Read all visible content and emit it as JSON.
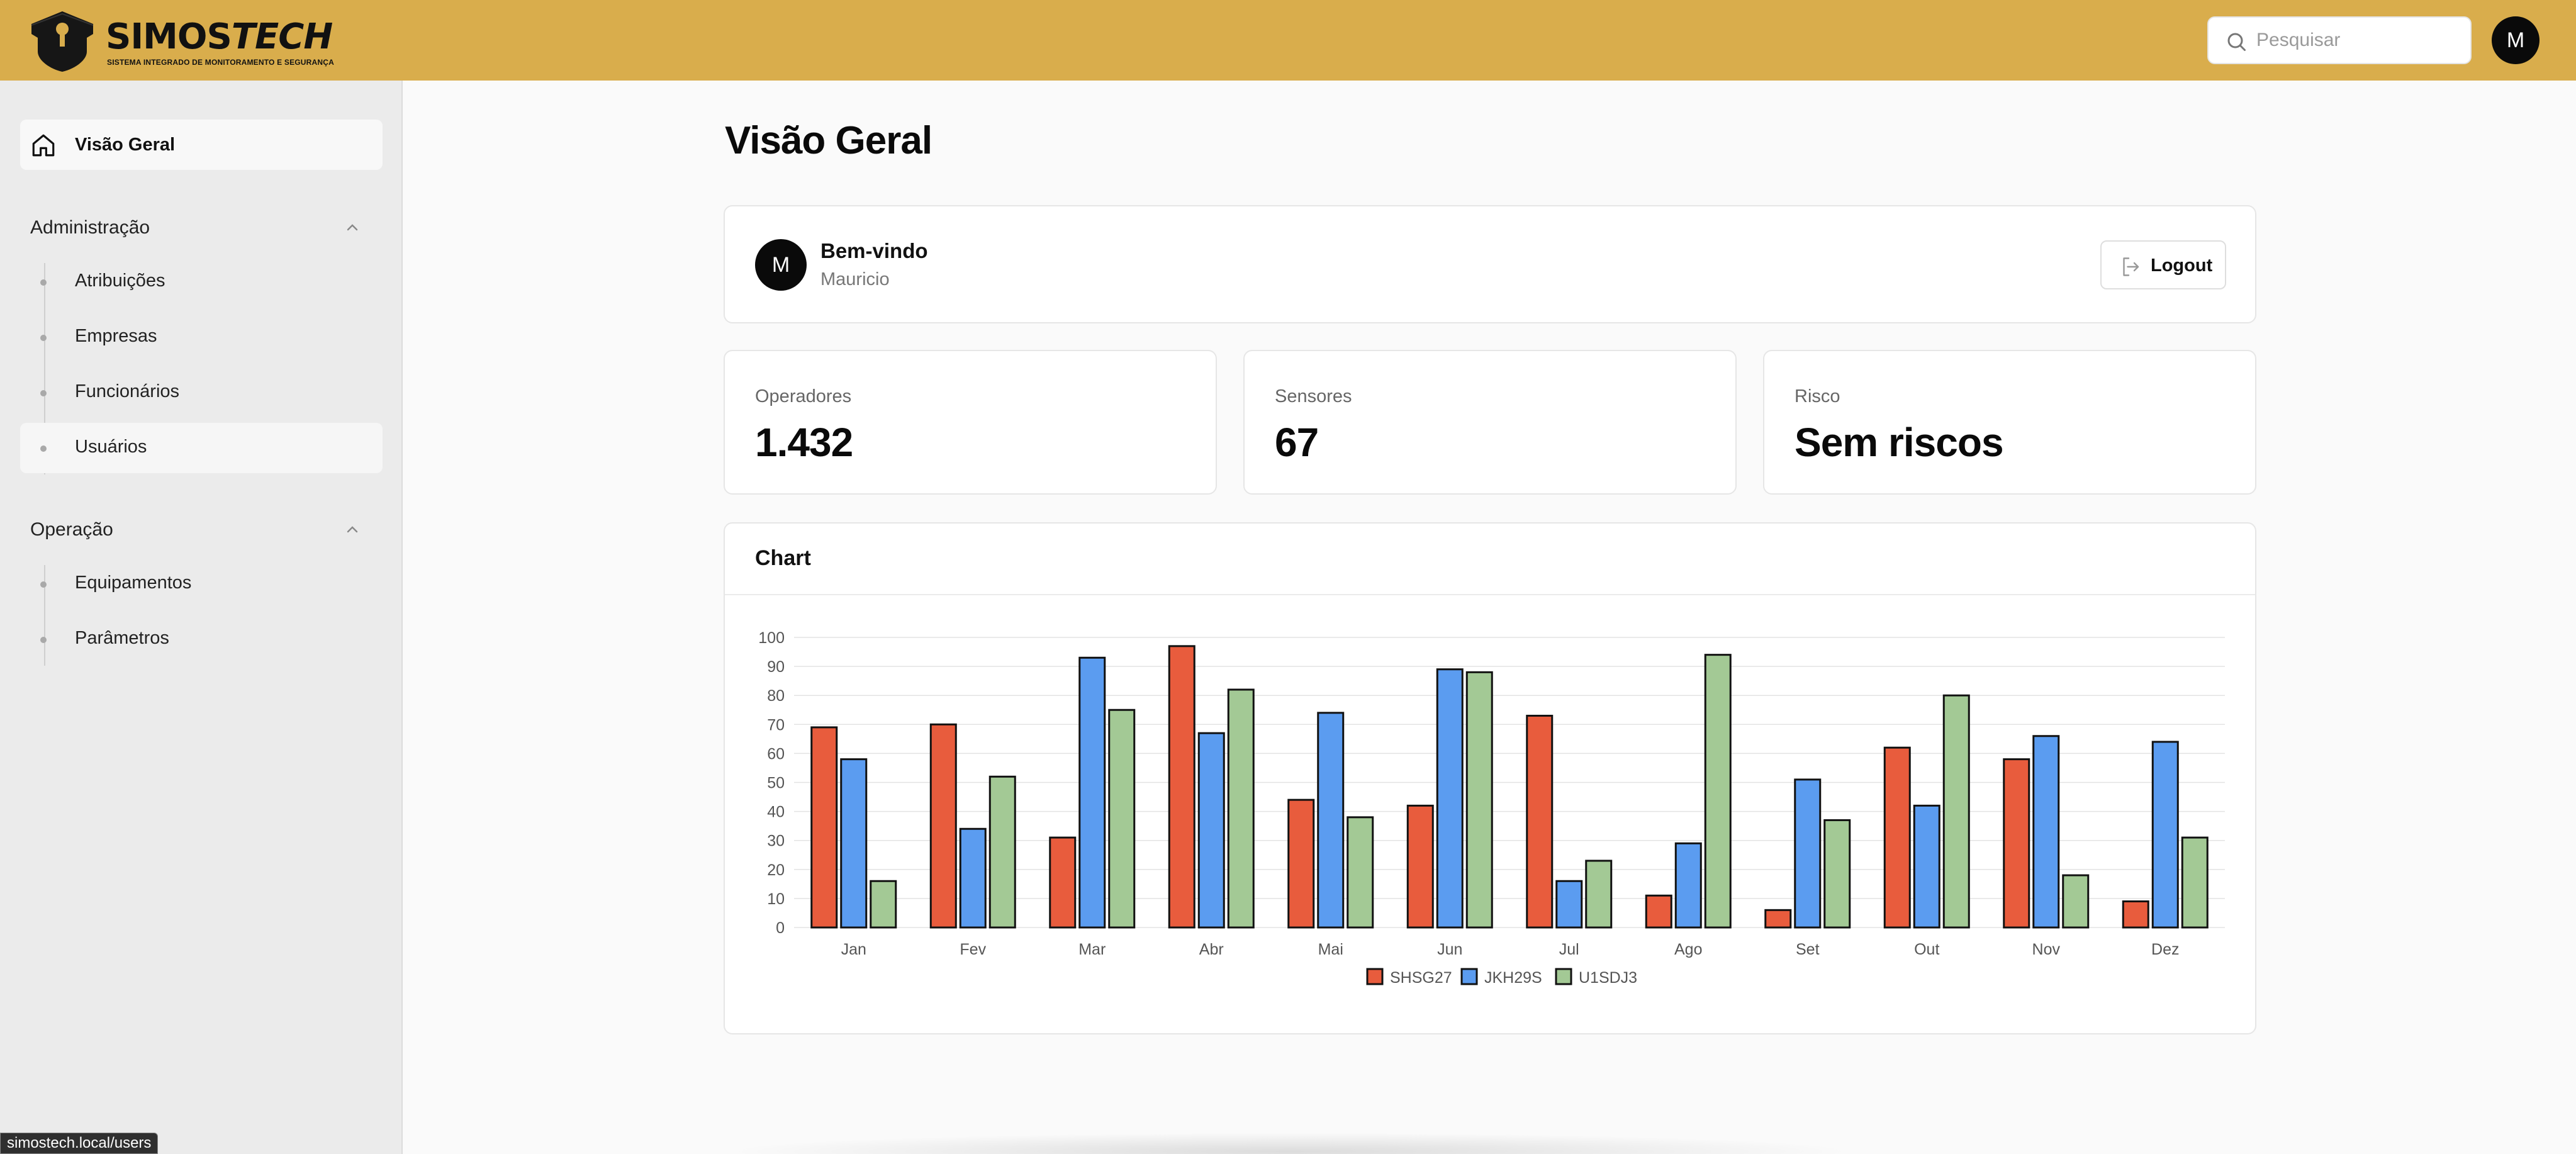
{
  "app": {
    "brand_main": "SIMOS",
    "brand_accent": "TECH",
    "brand_tagline": "SISTEMA INTEGRADO DE MONITORAMENTO E SEGURANÇA",
    "accent_color": "#d9ad4c"
  },
  "header": {
    "search_placeholder": "Pesquisar",
    "search_icon": "search-icon",
    "avatar_initial": "M"
  },
  "sidebar": {
    "home": {
      "label": "Visão Geral",
      "icon": "home-icon"
    },
    "groups": [
      {
        "label": "Administração",
        "items": [
          {
            "label": "Atribuições"
          },
          {
            "label": "Empresas"
          },
          {
            "label": "Funcionários"
          },
          {
            "label": "Usuários"
          }
        ]
      },
      {
        "label": "Operação",
        "items": [
          {
            "label": "Equipamentos"
          },
          {
            "label": "Parâmetros"
          }
        ]
      }
    ],
    "status_url": "simostech.local/users"
  },
  "main": {
    "title": "Visão Geral",
    "welcome": {
      "avatar_initial": "M",
      "title": "Bem-vindo",
      "name": "Mauricio",
      "logout_label": "Logout"
    },
    "stats": [
      {
        "label": "Operadores",
        "value": "1.432"
      },
      {
        "label": "Sensores",
        "value": "67"
      },
      {
        "label": "Risco",
        "value": "Sem riscos"
      }
    ],
    "chart_card_title": "Chart"
  },
  "chart_data": {
    "type": "bar",
    "categories": [
      "Jan",
      "Fev",
      "Mar",
      "Abr",
      "Mai",
      "Jun",
      "Jul",
      "Ago",
      "Set",
      "Out",
      "Nov",
      "Dez"
    ],
    "series": [
      {
        "name": "SHSG27",
        "color": "#e85c3d",
        "values": [
          69,
          70,
          31,
          97,
          44,
          42,
          73,
          11,
          6,
          62,
          58,
          9
        ]
      },
      {
        "name": "JKH29S",
        "color": "#5b9cf0",
        "values": [
          58,
          34,
          93,
          67,
          74,
          89,
          16,
          29,
          51,
          42,
          66,
          64
        ]
      },
      {
        "name": "U1SDJ3",
        "color": "#a3c995",
        "values": [
          16,
          52,
          75,
          82,
          38,
          88,
          23,
          94,
          37,
          80,
          18,
          31
        ]
      }
    ],
    "ylim": [
      0,
      100
    ],
    "yticks": [
      0,
      10,
      20,
      30,
      40,
      50,
      60,
      70,
      80,
      90,
      100
    ],
    "grid": true,
    "legend": "bottom-center"
  }
}
